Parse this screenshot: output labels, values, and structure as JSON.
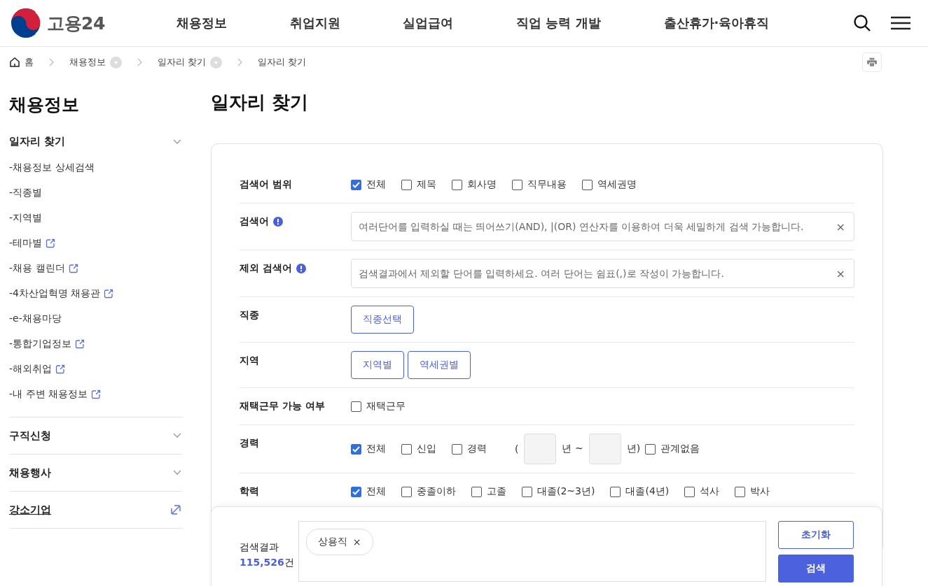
{
  "header": {
    "logo_text": "고용24",
    "nav": [
      "채용정보",
      "취업지원",
      "실업급여",
      "직업 능력 개발",
      "출산휴가·육아휴직"
    ]
  },
  "breadcrumb": {
    "home": "홈",
    "items": [
      {
        "label": "채용정보",
        "dropdown": true
      },
      {
        "label": "일자리 찾기",
        "dropdown": true
      },
      {
        "label": "일자리 찾기",
        "dropdown": false
      }
    ]
  },
  "sidebar": {
    "title": "채용정보",
    "sections": [
      {
        "label": "일자리 찾기",
        "kind": "toggle",
        "children": [
          {
            "label": "-채용정보 상세검색",
            "external": false
          },
          {
            "label": "-직종별",
            "external": false
          },
          {
            "label": "-지역별",
            "external": false
          },
          {
            "label": "-테마별",
            "external": true
          },
          {
            "label": "-채용 캘린더",
            "external": true
          },
          {
            "label": "-4차산업혁명 채용관",
            "external": true
          },
          {
            "label": "-e-채용마당",
            "external": false
          },
          {
            "label": "-통합기업정보",
            "external": true
          },
          {
            "label": "-해외취업",
            "external": true
          },
          {
            "label": "-내 주변 채용정보",
            "external": true
          }
        ]
      },
      {
        "label": "구직신청",
        "kind": "toggle"
      },
      {
        "label": "채용행사",
        "kind": "toggle"
      },
      {
        "label": "강소기업",
        "kind": "link"
      }
    ]
  },
  "page_title": "일자리 찾기",
  "form": {
    "rows": [
      {
        "label": "검색어 범위",
        "kind": "checkboxes",
        "info": false,
        "options": [
          {
            "label": "전체",
            "checked": true
          },
          {
            "label": "제목",
            "checked": false
          },
          {
            "label": "회사명",
            "checked": false
          },
          {
            "label": "직무내용",
            "checked": false
          },
          {
            "label": "역세권명",
            "checked": false
          }
        ]
      },
      {
        "label": "검색어",
        "kind": "input",
        "info": true,
        "placeholder": "여러단어를 입력하실 때는 띄어쓰기(AND), |(OR) 연산자를 이용하여 더욱 세밀하게 검색 가능합니다.",
        "clear": "×"
      },
      {
        "label": "제외 검색어",
        "kind": "input",
        "info": true,
        "placeholder": "검색결과에서 제외할 단어를 입력하세요. 여러 단어는 쉼표(,)로 작성이 가능합니다.",
        "clear": "×"
      },
      {
        "label": "직종",
        "kind": "buttons",
        "info": false,
        "buttons": [
          "직종선택"
        ]
      },
      {
        "label": "지역",
        "kind": "buttons",
        "info": false,
        "buttons": [
          "지역별",
          "역세권별"
        ]
      },
      {
        "label": "재택근무 가능 여부",
        "kind": "checkboxes",
        "info": false,
        "options": [
          {
            "label": "재택근무",
            "checked": false
          }
        ]
      },
      {
        "label": "경력",
        "kind": "career",
        "info": false,
        "options": [
          {
            "label": "전체",
            "checked": true
          },
          {
            "label": "신입",
            "checked": false
          },
          {
            "label": "경력",
            "checked": false
          }
        ],
        "range_open": "(",
        "from_unit": "년 ~",
        "to_unit": "년)",
        "extra": {
          "label": "관계없음",
          "checked": false
        }
      },
      {
        "label": "학력",
        "kind": "checkboxes",
        "info": false,
        "options": [
          {
            "label": "전체",
            "checked": true
          },
          {
            "label": "중졸이하",
            "checked": false
          },
          {
            "label": "고졸",
            "checked": false
          },
          {
            "label": "대졸(2~3년)",
            "checked": false
          },
          {
            "label": "대졸(4년)",
            "checked": false
          },
          {
            "label": "석사",
            "checked": false
          },
          {
            "label": "박사",
            "checked": false
          }
        ]
      }
    ]
  },
  "result": {
    "label": "검색결과",
    "count": "115,526",
    "unit": "건",
    "tags": [
      {
        "label": "상용직",
        "remove": "×"
      }
    ],
    "reset_button": "초기화",
    "search_button": "검색"
  }
}
